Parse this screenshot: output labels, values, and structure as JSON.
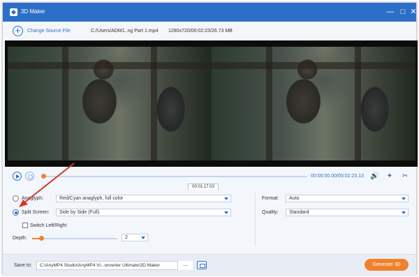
{
  "window": {
    "title": "3D Maker"
  },
  "source": {
    "change_label": "Change Source File",
    "file_path": "C:/Users/ADM1..ng Part 1.mp4",
    "file_info": "1280x720/00:02:23/26.73 MB"
  },
  "playback": {
    "time": "00:00:00.00/00:02:23.13",
    "tooltip": "00:01:17.03"
  },
  "settings": {
    "anaglyph_label": "Anaglyph:",
    "anaglyph_value": "Red/Cyan anaglyph, full color",
    "split_label": "Split Screen:",
    "split_value": "Side by Side (Full)",
    "switch_label": "Switch Left/Right",
    "depth_label": "Depth:",
    "depth_value": "2",
    "format_label": "Format:",
    "format_value": "Auto",
    "quality_label": "Quality:",
    "quality_value": "Standard"
  },
  "footer": {
    "save_label": "Save to:",
    "save_path": "C:\\AnyMP4 Studio\\AnyMP4 Vi...onverter Ultimate\\3D Maker",
    "dots_label": "...",
    "generate_label": "Generate 3D"
  },
  "colors": {
    "accent": "#2d6fc7",
    "orange": "#f0812c",
    "annotation_arrow": "#d9322b"
  },
  "icons": [
    "app-logo-icon",
    "minimize-icon",
    "maximize-icon",
    "close-icon",
    "plus-icon",
    "play-icon",
    "stop-icon",
    "volume-icon",
    "snapshot-icon",
    "cut-icon",
    "folder-icon"
  ]
}
